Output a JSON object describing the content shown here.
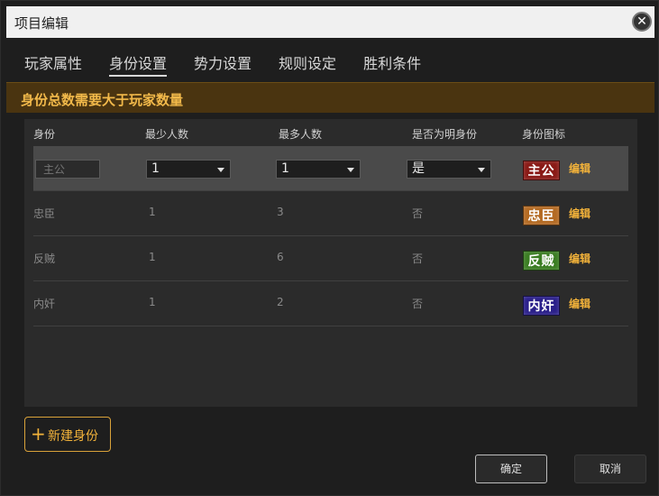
{
  "window": {
    "title": "项目编辑"
  },
  "tabs": [
    {
      "label": "玩家属性"
    },
    {
      "label": "身份设置"
    },
    {
      "label": "势力设置"
    },
    {
      "label": "规则设定"
    },
    {
      "label": "胜利条件"
    }
  ],
  "warning": "身份总数需要大于玩家数量",
  "table": {
    "headers": [
      "身份",
      "最少人数",
      "最多人数",
      "是否为明身份",
      "身份图标"
    ],
    "edit_row": {
      "name_placeholder": "主公",
      "min": "1",
      "max": "1",
      "revealed": "是",
      "icon_text": "主公",
      "icon_color": "#8a1a16",
      "edit_label": "编辑"
    },
    "rows": [
      {
        "name": "忠臣",
        "min": "1",
        "max": "3",
        "revealed": "否",
        "icon_text": "忠臣",
        "icon_color": "#b46a22",
        "edit_label": "编辑"
      },
      {
        "name": "反贼",
        "min": "1",
        "max": "6",
        "revealed": "否",
        "icon_text": "反贼",
        "icon_color": "#3a7d22",
        "edit_label": "编辑"
      },
      {
        "name": "内奸",
        "min": "1",
        "max": "2",
        "revealed": "否",
        "icon_text": "内奸",
        "icon_color": "#2a1f8a",
        "edit_label": "编辑"
      }
    ]
  },
  "buttons": {
    "new_identity": "新建身份",
    "confirm": "确定",
    "cancel": "取消"
  }
}
